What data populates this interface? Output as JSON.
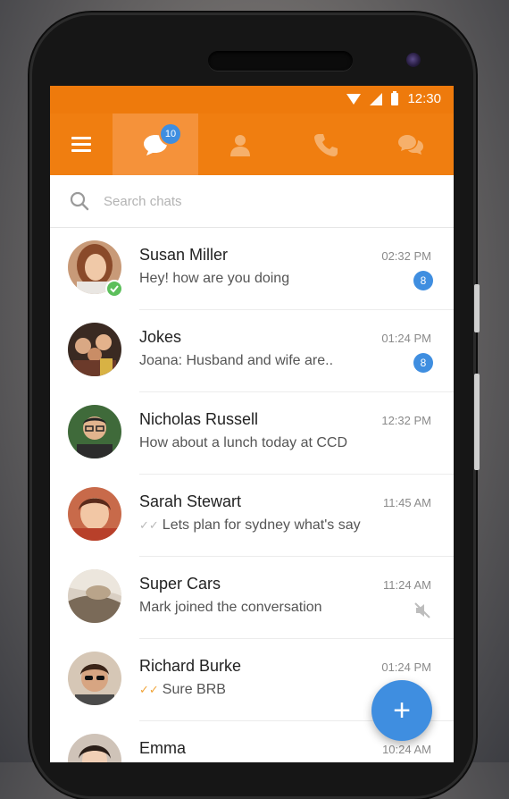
{
  "status": {
    "time": "12:30"
  },
  "toolbar": {
    "tabs": [
      {
        "icon": "chat-bubble-icon",
        "badge": "10"
      },
      {
        "icon": "person-icon"
      },
      {
        "icon": "phone-icon"
      },
      {
        "icon": "group-chat-icon"
      }
    ]
  },
  "search": {
    "placeholder": "Search chats"
  },
  "chats": [
    {
      "name": "Susan Miller",
      "message": "Hey! how are you doing",
      "time": "02:32 PM",
      "unread": "8",
      "online": true
    },
    {
      "name": "Jokes",
      "message": "Joana: Husband and wife are..",
      "time": "01:24 PM",
      "unread": "8"
    },
    {
      "name": "Nicholas Russell",
      "message": "How about a lunch today at CCD",
      "time": "12:32 PM"
    },
    {
      "name": "Sarah Stewart",
      "message": "Lets plan for sydney what's say",
      "time": "11:45 AM",
      "tick": "✓✓"
    },
    {
      "name": "Super Cars",
      "message": "Mark joined the conversation",
      "time": "11:24 AM",
      "muted": true
    },
    {
      "name": "Richard Burke",
      "message": "Sure BRB",
      "time": "01:24 PM",
      "tick": "✓✓"
    },
    {
      "name": "Emma",
      "message": "",
      "time": "10:24 AM"
    }
  ],
  "fab": {
    "label": "+"
  },
  "colors": {
    "accent": "#f07e10",
    "badge": "#3f8ee0",
    "online": "#5cbf5b"
  }
}
